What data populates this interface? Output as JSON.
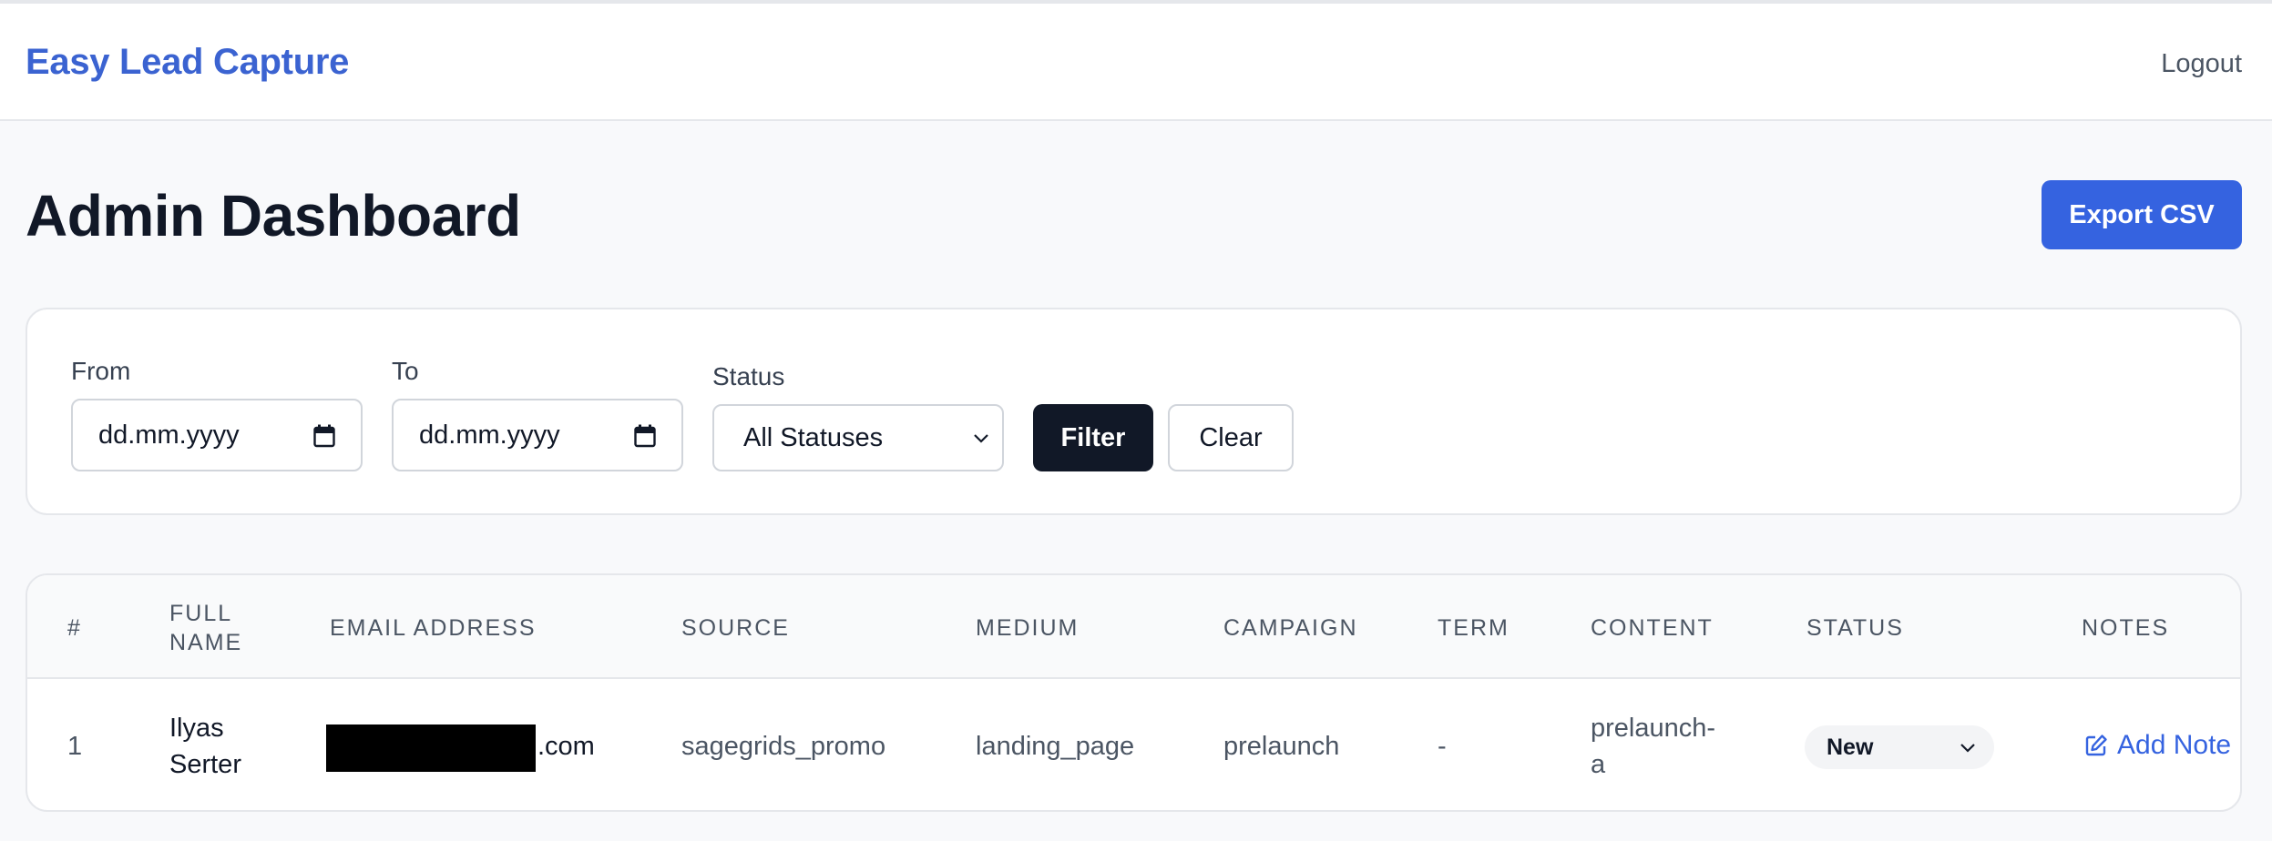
{
  "header": {
    "brand": "Easy Lead Capture",
    "logout_label": "Logout"
  },
  "page": {
    "title": "Admin Dashboard",
    "export_label": "Export CSV"
  },
  "filters": {
    "from_label": "From",
    "from_value": "dd.mm.yyyy",
    "to_label": "To",
    "to_value": "dd.mm.yyyy",
    "status_label": "Status",
    "status_value": "All Statuses",
    "filter_label": "Filter",
    "clear_label": "Clear"
  },
  "table": {
    "columns": {
      "num": "#",
      "full_name_1": "FULL",
      "full_name_2": "NAME",
      "email": "EMAIL ADDRESS",
      "source": "SOURCE",
      "medium": "MEDIUM",
      "campaign": "CAMPAIGN",
      "term": "TERM",
      "content": "CONTENT",
      "status": "STATUS",
      "notes": "NOTES"
    },
    "rows": [
      {
        "num": "1",
        "name_line1": "Ilyas",
        "name_line2": "Serter",
        "email_suffix": ".com",
        "source": "sagegrids_promo",
        "medium": "landing_page",
        "campaign": "prelaunch",
        "term": "-",
        "content_line1": "prelaunch-",
        "content_line2": "a",
        "status": "New",
        "notes_label": "Add Note"
      }
    ]
  },
  "icons": [
    "calendar-icon",
    "chevron-down-icon",
    "edit-note-icon"
  ],
  "colors": {
    "brand": "#3b63d1",
    "primary": "#3563e0",
    "dark_button": "#111827"
  }
}
